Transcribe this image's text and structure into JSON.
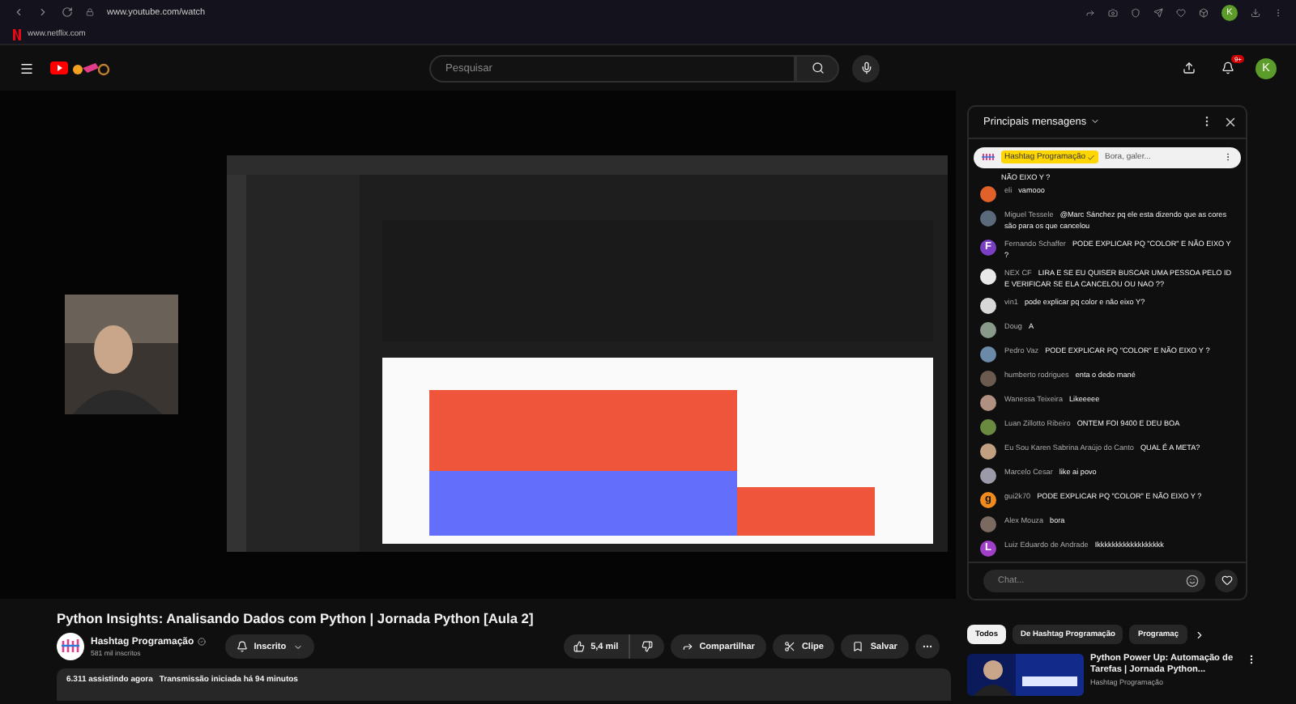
{
  "browser": {
    "url": "www.youtube.com/watch",
    "bookmark": "www.netflix.com",
    "profile": "K"
  },
  "header": {
    "search_placeholder": "Pesquisar",
    "notification_count": "9+",
    "avatar": "K"
  },
  "video": {
    "title": "Python Insights: Analisando Dados com Python | Jornada Python [Aula 2]"
  },
  "channel": {
    "name": "Hashtag Programação",
    "verified": true,
    "subscribers": "581 mil inscritos",
    "subscribe_label": "Inscrito"
  },
  "actions": {
    "likes": "5,4 mil",
    "share": "Compartilhar",
    "clip": "Clipe",
    "save": "Salvar"
  },
  "description": {
    "viewers": "6.311 assistindo agora",
    "started": "Transmissão iniciada há 94 minutos"
  },
  "chat": {
    "title": "Principais mensagens",
    "pinned": {
      "author": "Hashtag Programação",
      "text": "Bora, galer..."
    },
    "partial": "NÃO EIXO Y ?",
    "placeholder": "Chat...",
    "messages": [
      {
        "author": "eli",
        "text": "vamooo",
        "color": "#e0622a"
      },
      {
        "author": "Miguel Tessele",
        "text": "@Marc Sánchez pq ele esta dizendo que as cores são para os que cancelou",
        "color": "#5a6a7a"
      },
      {
        "author": "Fernando Schaffer",
        "text": "PODE EXPLICAR PQ \"COLOR\" E NÃO EIXO Y ?",
        "color": "#7b3fc4",
        "initial": "F"
      },
      {
        "author": "NEX CF",
        "text": "LIRA E SE EU QUISER BUSCAR UMA PESSOA PELO ID E VERIFICAR SE ELA CANCELOU OU NAO ??",
        "color": "#e8e8e8"
      },
      {
        "author": "vin1",
        "text": "pode explicar pq color e não eixo Y?",
        "color": "#d8d8d8"
      },
      {
        "author": "Doug",
        "text": "A",
        "color": "#8a9a8a"
      },
      {
        "author": "Pedro Vaz",
        "text": "PODE EXPLICAR PQ \"COLOR\" E NÃO EIXO Y ?",
        "color": "#6a8aa8"
      },
      {
        "author": "humberto rodrigues",
        "text": "enta o dedo mané",
        "color": "#6a5a50"
      },
      {
        "author": "Wanessa Teixeira",
        "text": "Likeeeee",
        "color": "#b09080"
      },
      {
        "author": "Luan Zillotto Ribeiro",
        "text": "ONTEM FOI 9400 E DEU BOA",
        "color": "#6a8a40"
      },
      {
        "author": "Eu Sou Karen Sabrina Araújo do Canto",
        "text": "QUAL É A META?",
        "color": "#c0a080"
      },
      {
        "author": "Marcelo Cesar",
        "text": "like ai povo",
        "color": "#9a9aa8"
      },
      {
        "author": "gui2k70",
        "text": "PODE EXPLICAR PQ \"COLOR\" E NÃO EIXO Y ?",
        "color": "#f08a1c",
        "initial": "g"
      },
      {
        "author": "Alex Mouza",
        "text": "bora",
        "color": "#7a6a60"
      },
      {
        "author": "Luiz Eduardo de Andrade",
        "text": "Ikkkkkkkkkkkkkkkkkk",
        "color": "#a040c8",
        "initial": "L"
      }
    ]
  },
  "chips": [
    {
      "label": "Todos",
      "selected": true
    },
    {
      "label": "De Hashtag Programação",
      "selected": false
    },
    {
      "label": "Programaç",
      "selected": false
    }
  ],
  "recommendation": {
    "title": "Python Power Up: Automação de Tarefas | Jornada Python...",
    "channel": "Hashtag Programação"
  }
}
